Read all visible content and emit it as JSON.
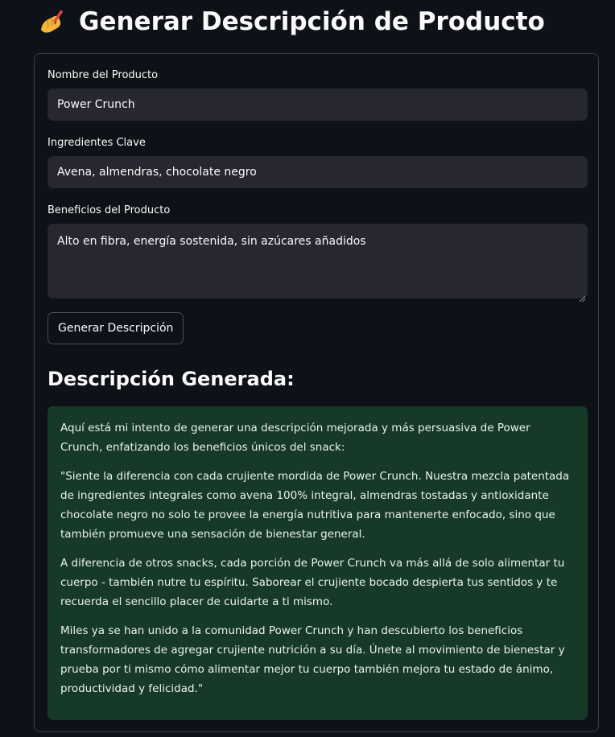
{
  "header": {
    "title": "Generar Descripción de Producto",
    "icon": "writing-hand-icon"
  },
  "form": {
    "product_name": {
      "label": "Nombre del Producto",
      "value": "Power Crunch"
    },
    "key_ingredients": {
      "label": "Ingredientes Clave",
      "value": "Avena, almendras, chocolate negro"
    },
    "product_benefits": {
      "label": "Beneficios del Producto",
      "value": "Alto en fibra, energía sostenida, sin azúcares añadidos"
    },
    "generate_button_label": "Generar Descripción"
  },
  "result": {
    "heading": "Descripción Generada:",
    "paragraphs": [
      "Aquí está mi intento de generar una descripción mejorada y más persuasiva de Power Crunch, enfatizando los beneficios únicos del snack:",
      "\"Siente la diferencia con cada crujiente mordida de Power Crunch. Nuestra mezcla patentada de ingredientes integrales como avena 100% integral, almendras tostadas y antioxidante chocolate negro no solo te provee la energía nutritiva para mantenerte enfocado, sino que también promueve una sensación de bienestar general.",
      "A diferencia de otros snacks, cada porción de Power Crunch va más allá de solo alimentar tu cuerpo - también nutre tu espíritu. Saborear el crujiente bocado despierta tus sentidos y te recuerda el sencillo placer de cuidarte a ti mismo.",
      "Miles ya se han unido a la comunidad Power Crunch y han descubierto los beneficios transformadores de agregar crujiente nutrición a su día. Únete al movimiento de bienestar y prueba por ti mismo cómo alimentar mejor tu cuerpo también mejora tu estado de ánimo, productividad y felicidad.\""
    ]
  },
  "colors": {
    "background": "#0e1117",
    "input_background": "#262730",
    "result_background": "#173928",
    "text": "#fafafa"
  }
}
